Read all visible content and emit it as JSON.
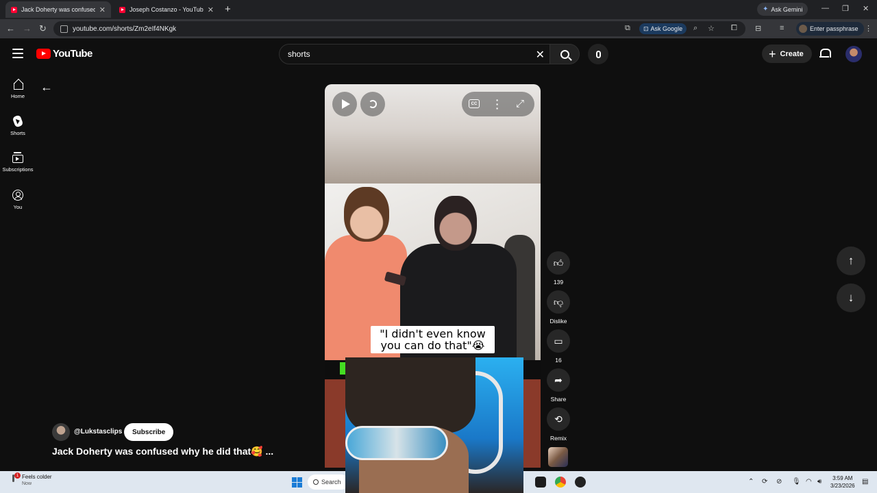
{
  "browser": {
    "tabs": [
      {
        "title": "Jack Doherty was confused why",
        "active": true
      },
      {
        "title": "Joseph Costanzo - YouTube",
        "active": false
      }
    ],
    "gemini_label": "Ask Gemini",
    "url": "youtube.com/shorts/Zm2eIf4NKgk",
    "ask_google": "Ask Google",
    "profile_label": "Enter passphrase"
  },
  "header": {
    "logo_text": "YouTube",
    "search_value": "shorts",
    "create_label": "Create"
  },
  "sidebar": {
    "items": [
      {
        "label": "Home",
        "icon": "home-icon"
      },
      {
        "label": "Shorts",
        "icon": "shorts-icon"
      },
      {
        "label": "Subscriptions",
        "icon": "subscriptions-icon"
      },
      {
        "label": "You",
        "icon": "you-icon"
      }
    ]
  },
  "video": {
    "caption_line1": "\"I didn't even know",
    "caption_line2": "you can do that\"😭"
  },
  "actions": {
    "like_count": "139",
    "dislike_label": "Dislike",
    "comment_count": "16",
    "share_label": "Share",
    "remix_label": "Remix"
  },
  "channel": {
    "handle": "@Lukstasclips",
    "subscribe_label": "Subscribe",
    "title": "Jack Doherty was confused why he did that🥰 ..."
  },
  "taskbar": {
    "weather_badge": "1",
    "weather_text": "Feels colder",
    "weather_sub": "Now",
    "search_label": "Search",
    "time": "3:59 AM",
    "date": "3/23/2026"
  },
  "colors": {
    "youtube_red": "#ff0000",
    "page_bg": "#0f0f0f",
    "taskbar_bg": "#dfe7f0"
  }
}
